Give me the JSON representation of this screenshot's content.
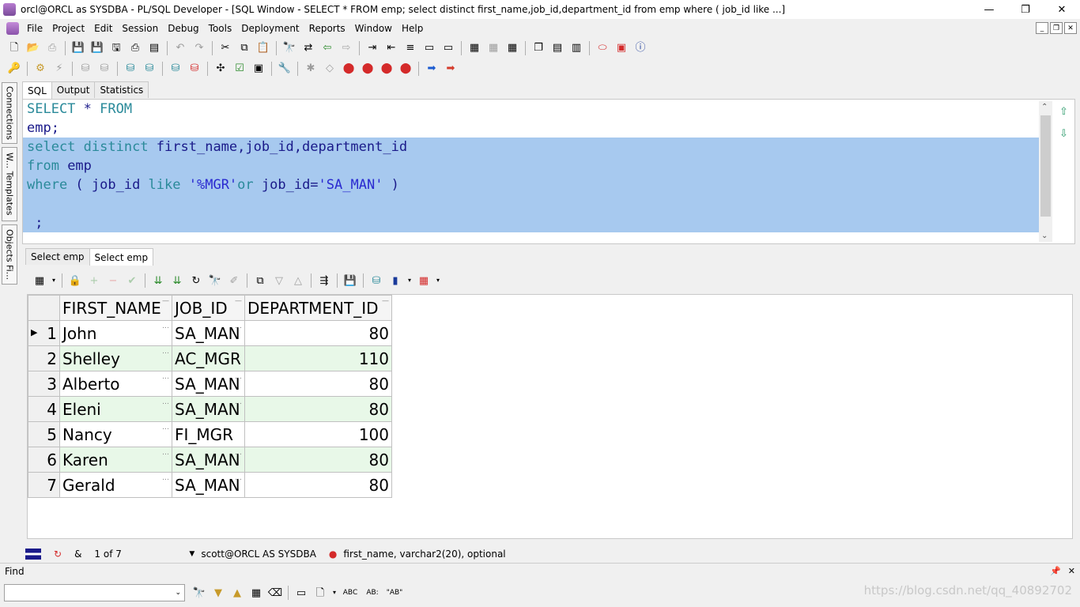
{
  "window": {
    "title": "orcl@ORCL as SYSDBA - PL/SQL Developer - [SQL Window - SELECT * FROM emp; select distinct first_name,job_id,department_id from emp where ( job_id like  ...]",
    "minimize": "—",
    "maximize": "❐",
    "close": "✕"
  },
  "menu": [
    "File",
    "Project",
    "Edit",
    "Session",
    "Debug",
    "Tools",
    "Deployment",
    "Reports",
    "Window",
    "Help"
  ],
  "side_tabs": [
    "Connections",
    "W... Templates",
    "Objects Fi..."
  ],
  "editor_tabs": [
    {
      "label": "SQL",
      "active": true
    },
    {
      "label": "Output",
      "active": false
    },
    {
      "label": "Statistics",
      "active": false
    }
  ],
  "sql_lines": [
    {
      "tokens": [
        [
          "kw",
          "SELECT"
        ],
        [
          "id",
          " * "
        ],
        [
          "kw",
          "FROM"
        ]
      ],
      "selected": false
    },
    {
      "tokens": [
        [
          "id",
          "emp;"
        ]
      ],
      "selected": false
    },
    {
      "tokens": [
        [
          "kw",
          "select"
        ],
        [
          "id",
          " "
        ],
        [
          "kw",
          "distinct"
        ],
        [
          "id",
          " first_name,job_id,department_id"
        ]
      ],
      "selected": true
    },
    {
      "tokens": [
        [
          "kw",
          "from"
        ],
        [
          "id",
          " emp"
        ]
      ],
      "selected": true
    },
    {
      "tokens": [
        [
          "kw",
          "where"
        ],
        [
          "id",
          " ( job_id "
        ],
        [
          "kw",
          "like"
        ],
        [
          "id",
          " "
        ],
        [
          "str",
          "'%MGR'"
        ],
        [
          "kw",
          "or"
        ],
        [
          "id",
          " job_id="
        ],
        [
          "str",
          "'SA_MAN'"
        ],
        [
          "id",
          " )"
        ]
      ],
      "selected": true
    },
    {
      "tokens": [
        [
          "id",
          " "
        ]
      ],
      "selected": true
    },
    {
      "tokens": [
        [
          "id",
          " ;"
        ]
      ],
      "selected": true
    }
  ],
  "result_tabs": [
    {
      "label": "Select emp",
      "active": false
    },
    {
      "label": "Select emp",
      "active": true
    }
  ],
  "grid": {
    "columns": [
      "FIRST_NAME",
      "JOB_ID",
      "DEPARTMENT_ID"
    ],
    "rows": [
      {
        "n": "1",
        "first_name": "John",
        "job_id": "SA_MAN",
        "department_id": "80"
      },
      {
        "n": "2",
        "first_name": "Shelley",
        "job_id": "AC_MGR",
        "department_id": "110"
      },
      {
        "n": "3",
        "first_name": "Alberto",
        "job_id": "SA_MAN",
        "department_id": "80"
      },
      {
        "n": "4",
        "first_name": "Eleni",
        "job_id": "SA_MAN",
        "department_id": "80"
      },
      {
        "n": "5",
        "first_name": "Nancy",
        "job_id": "FI_MGR",
        "department_id": "100"
      },
      {
        "n": "6",
        "first_name": "Karen",
        "job_id": "SA_MAN",
        "department_id": "80"
      },
      {
        "n": "7",
        "first_name": "Gerald",
        "job_id": "SA_MAN",
        "department_id": "80"
      }
    ]
  },
  "status": {
    "record": "1 of 7",
    "connection": "scott@ORCL AS SYSDBA",
    "column_info": "first_name, varchar2(20), optional"
  },
  "find": {
    "label": "Find",
    "value": ""
  },
  "watermark": "https://blog.csdn.net/qq_40892702"
}
